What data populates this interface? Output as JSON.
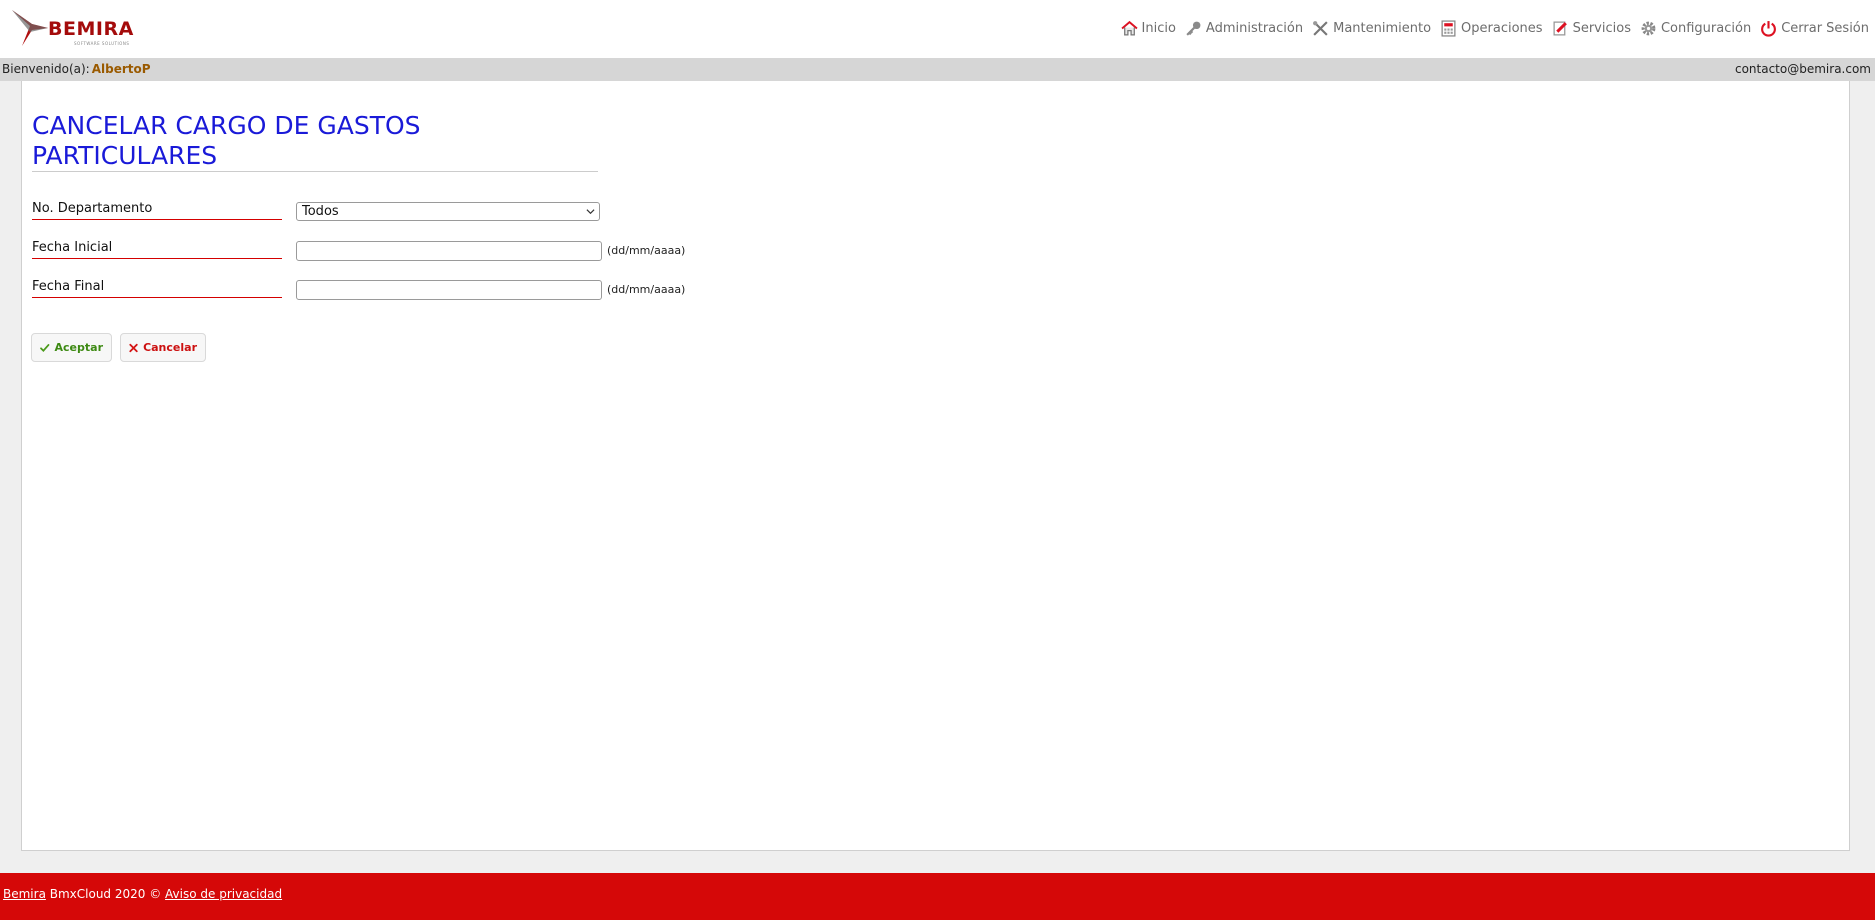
{
  "brand": {
    "name": "BEMIRA",
    "tagline": "SOFTWARE SOLUTIONS",
    "accent": "#d50808"
  },
  "nav": [
    {
      "label": "Inicio",
      "icon": "home-icon"
    },
    {
      "label": "Administración",
      "icon": "key-icon"
    },
    {
      "label": "Mantenimiento",
      "icon": "tools-icon"
    },
    {
      "label": "Operaciones",
      "icon": "calculator-icon"
    },
    {
      "label": "Servicios",
      "icon": "edit-icon"
    },
    {
      "label": "Configuración",
      "icon": "gear-icon"
    },
    {
      "label": "Cerrar Sesión",
      "icon": "power-icon"
    }
  ],
  "welcome": {
    "prefix": "Bienvenido(a):",
    "user": "AlbertoP",
    "email": "contacto@bemira.com"
  },
  "page": {
    "title": "CANCELAR CARGO DE GASTOS PARTICULARES"
  },
  "form": {
    "department_label": "No. Departamento",
    "department_value": "Todos",
    "start_label": "Fecha Inicial",
    "start_value": "",
    "start_hint": "(dd/mm/aaaa)",
    "end_label": "Fecha Final",
    "end_value": "",
    "end_hint": "(dd/mm/aaaa)",
    "accept_label": "Aceptar",
    "cancel_label": "Cancelar"
  },
  "footer": {
    "brand_link": "Bemira",
    "copyright": " BmxCloud 2020 © ",
    "privacy_link": "Aviso de privacidad"
  }
}
